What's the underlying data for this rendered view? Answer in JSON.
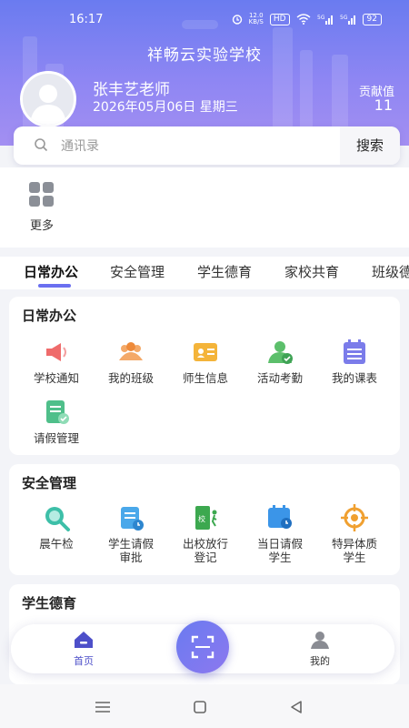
{
  "status": {
    "time": "16:17",
    "speed": "12.0\nKB/S",
    "hd": "HD",
    "sig1": "5G",
    "sig2": "5G",
    "battery": "92"
  },
  "header": {
    "school": "祥畅云实验学校",
    "teacher": "张丰艺老师",
    "date": "2026年05月06日 星期三",
    "contrib_label": "贡献值",
    "contrib_value": "11"
  },
  "search": {
    "placeholder": "通讯录",
    "button": "搜索"
  },
  "more": {
    "label": "更多"
  },
  "tabs": [
    "日常办公",
    "安全管理",
    "学生德育",
    "家校共育",
    "班级德"
  ],
  "sections": {
    "daily": {
      "title": "日常办公",
      "items": [
        "学校通知",
        "我的班级",
        "师生信息",
        "活动考勤",
        "我的课表",
        "请假管理"
      ]
    },
    "safety": {
      "title": "安全管理",
      "items": [
        [
          "晨午检"
        ],
        [
          "学生请假",
          "审批"
        ],
        [
          "出校放行",
          "登记"
        ],
        [
          "当日请假",
          "学生"
        ],
        [
          "特异体质",
          "学生"
        ]
      ]
    },
    "moral": {
      "title": "学生德育"
    }
  },
  "nav": {
    "home": "首页",
    "me": "我的"
  },
  "colors": {
    "accent": "#6a7bf0",
    "accent2": "#a38ff2"
  }
}
